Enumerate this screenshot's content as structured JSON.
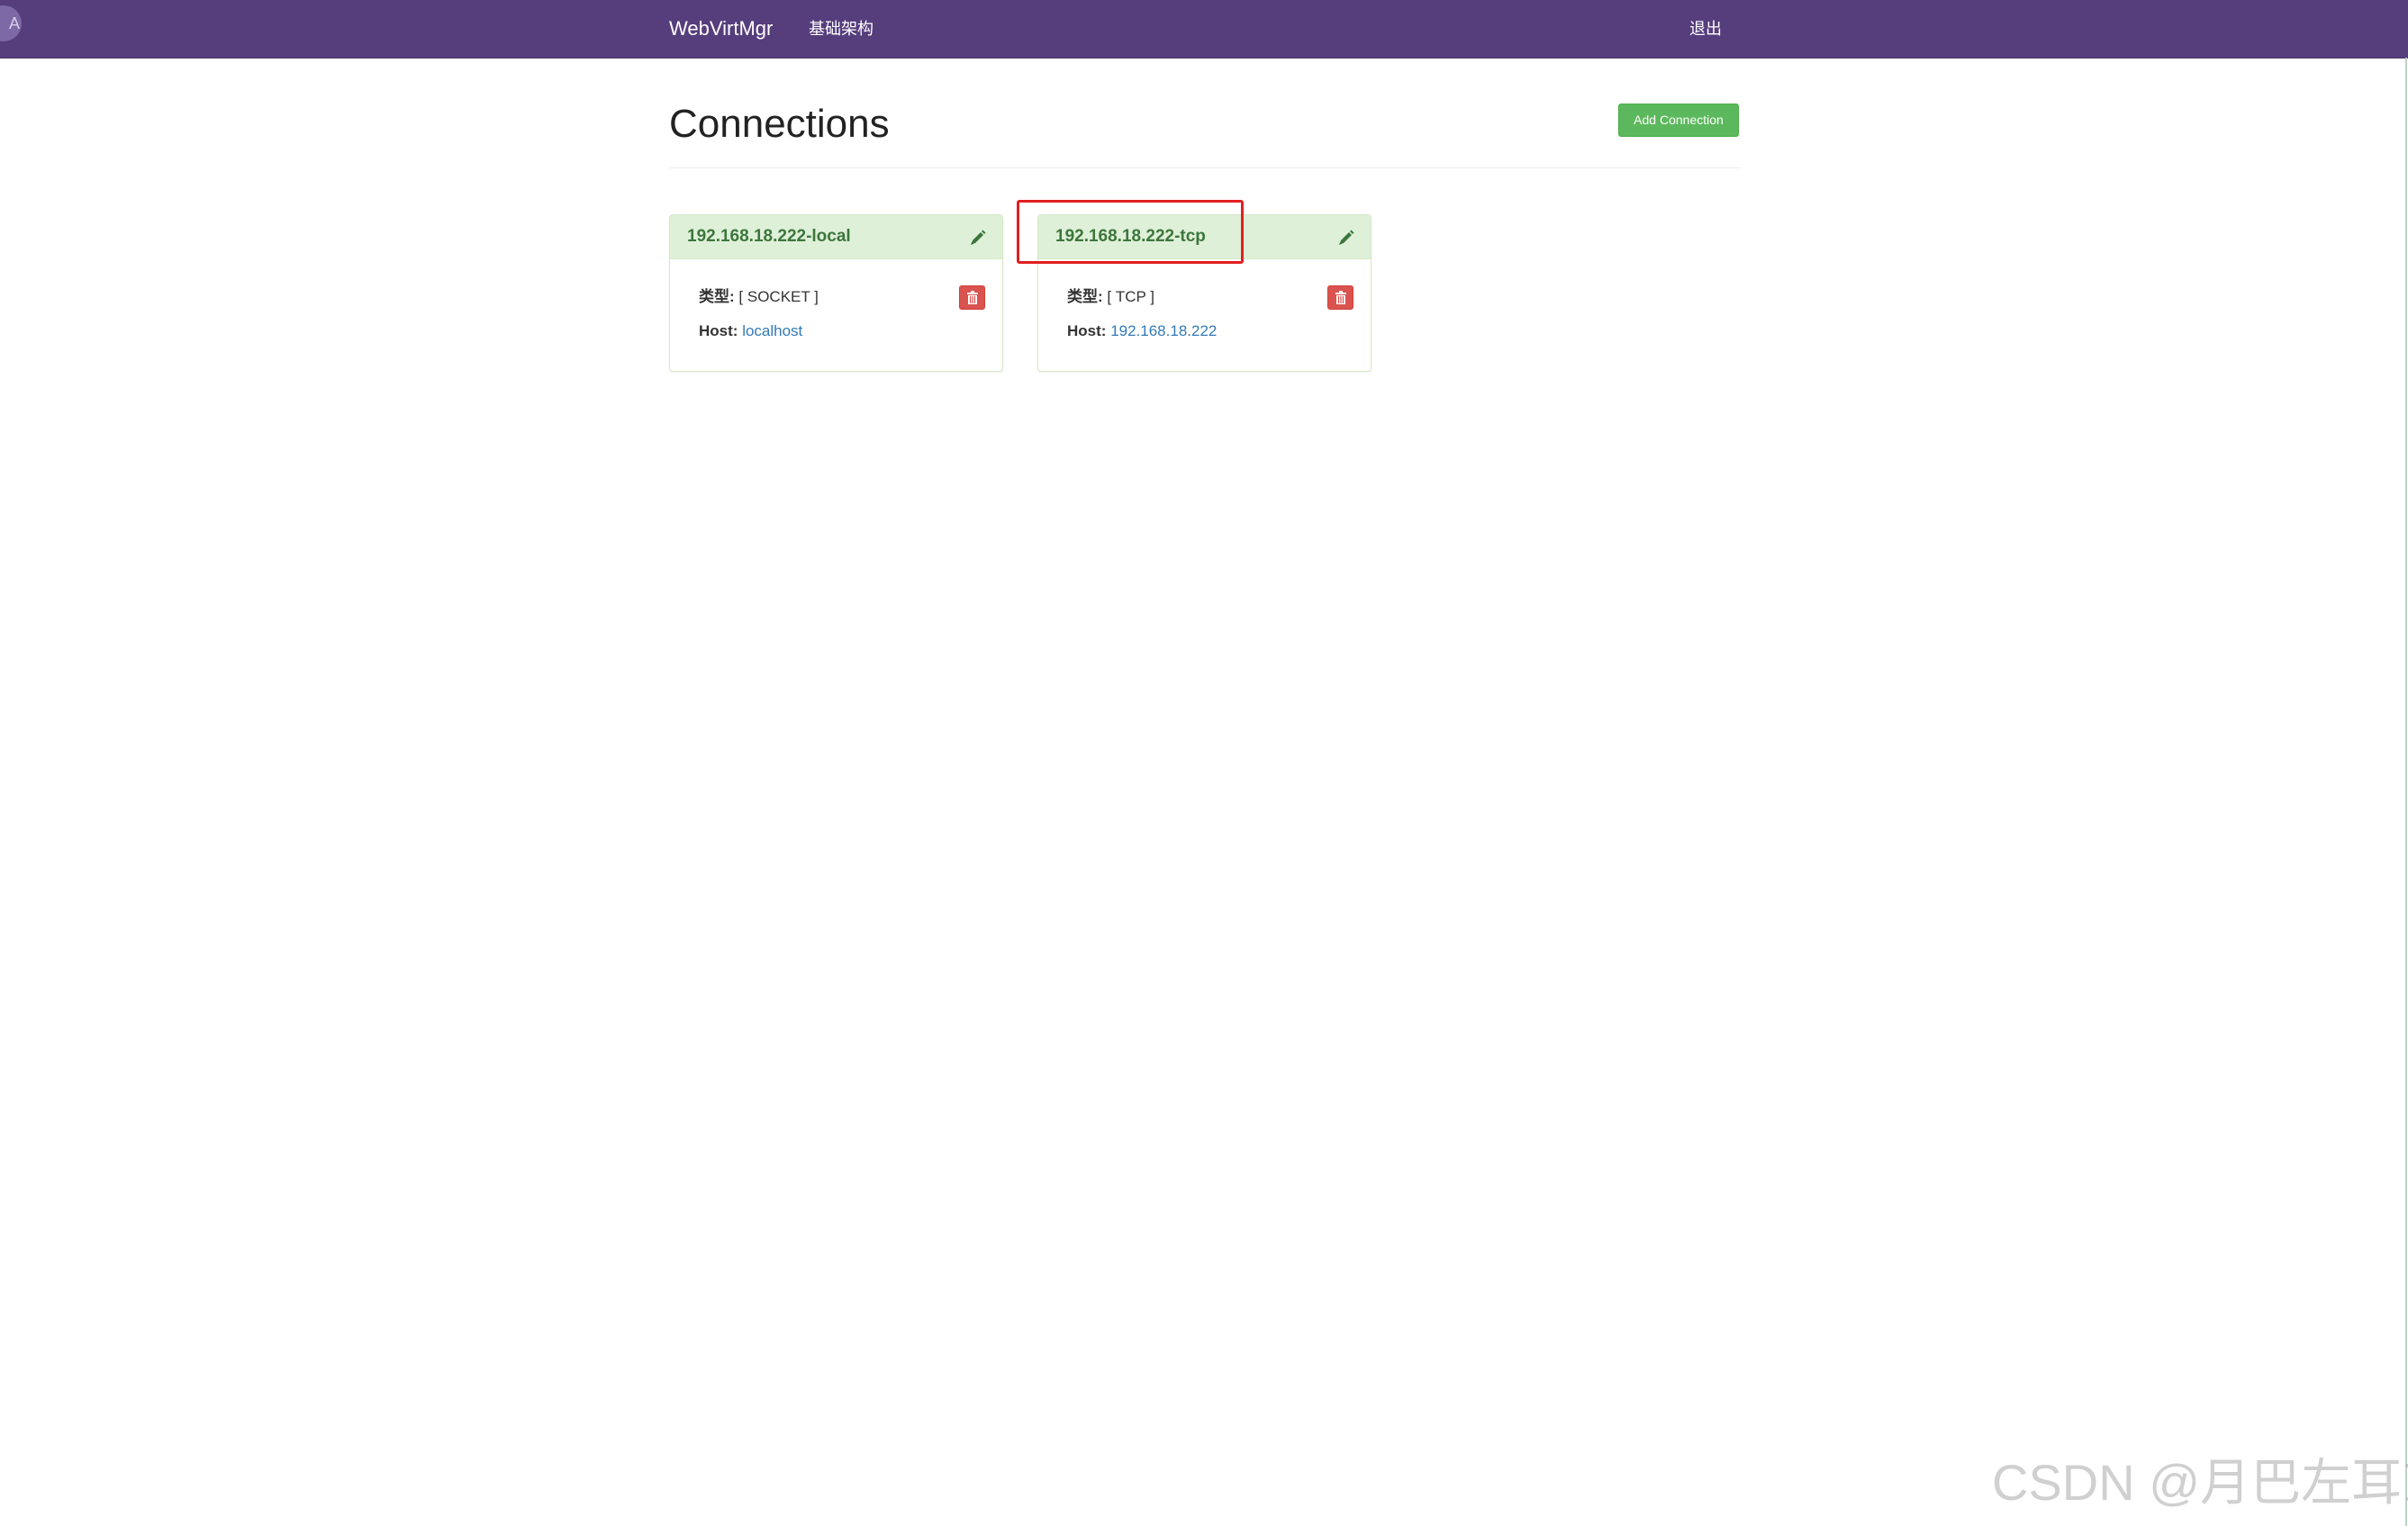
{
  "navbar": {
    "avatar_letter": "A",
    "brand": "WebVirtMgr",
    "infrastructure_link": "基础架构",
    "logout_link": "退出"
  },
  "page": {
    "title": "Connections",
    "add_button": "Add Connection"
  },
  "connections": [
    {
      "name": "192.168.18.222-local",
      "type_label": "类型:",
      "type_value": "[ SOCKET ]",
      "host_label": "Host:",
      "host_value": "localhost"
    },
    {
      "name": "192.168.18.222-tcp",
      "type_label": "类型:",
      "type_value": "[ TCP ]",
      "host_label": "Host:",
      "host_value": "192.168.18.222"
    }
  ],
  "colors": {
    "navbar": "#563d7c",
    "panel_header": "#dff0d8",
    "panel_title": "#3c763d",
    "add_button": "#5cb85c",
    "delete_button": "#d9534f",
    "link": "#337ab7",
    "annotation": "#e02020"
  },
  "icons": {
    "edit": "pencil-icon",
    "delete": "trash-icon"
  },
  "watermark": "CSDN @月巴左耳东"
}
